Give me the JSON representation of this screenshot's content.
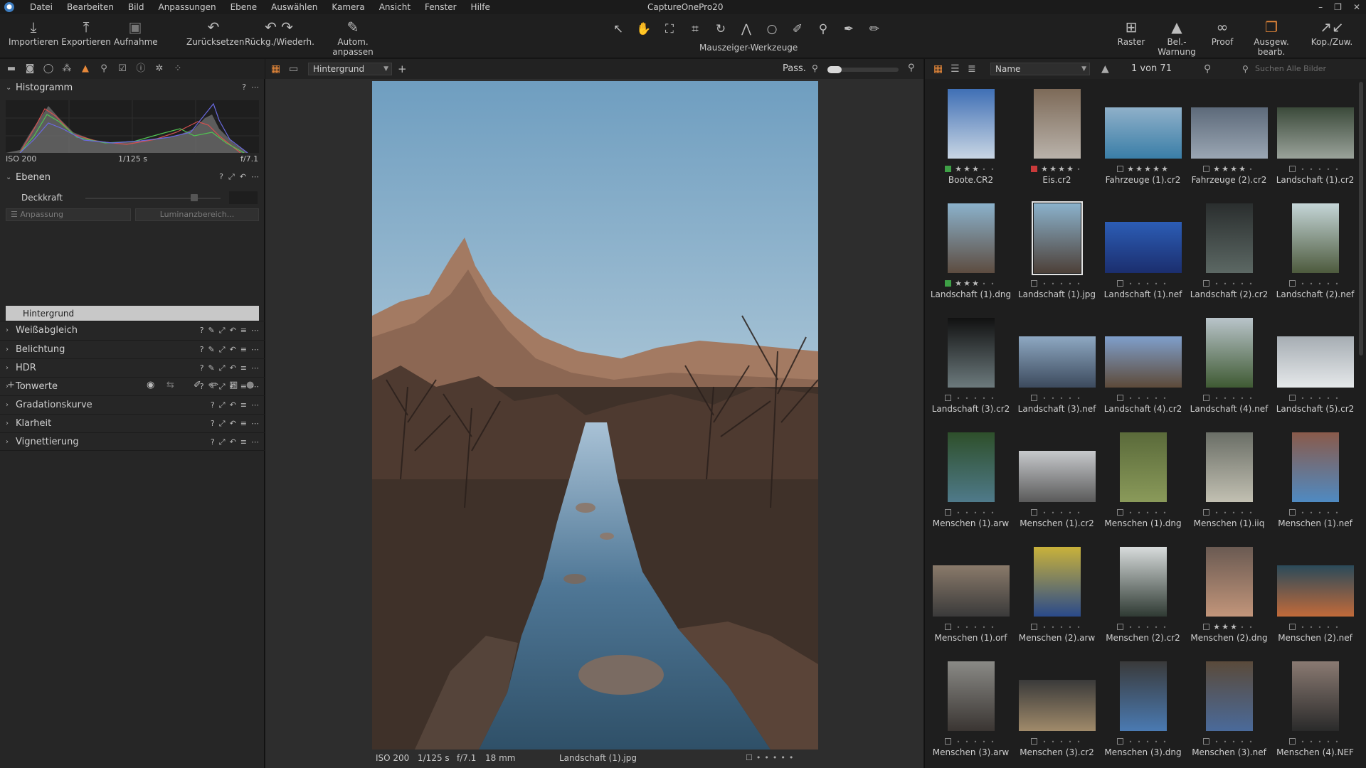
{
  "app": {
    "title": "CaptureOnePro20"
  },
  "menu": [
    "Datei",
    "Bearbeiten",
    "Bild",
    "Anpassungen",
    "Ebene",
    "Auswählen",
    "Kamera",
    "Ansicht",
    "Fenster",
    "Hilfe"
  ],
  "window_controls": [
    "–",
    "❐",
    "✕"
  ],
  "toolbar": {
    "left": [
      {
        "label": "Importieren",
        "icon": "import-icon"
      },
      {
        "label": "Exportieren",
        "icon": "export-icon"
      },
      {
        "label": "Aufnahme",
        "icon": "camera-icon"
      },
      {
        "label": "Zurücksetzen",
        "icon": "reset-icon"
      },
      {
        "label": "Rückg./Wiederh.",
        "icon": "undo-redo-icon"
      },
      {
        "label": "Autom. anpassen",
        "icon": "auto-adjust-icon"
      }
    ],
    "cursor_tools_label": "Mauszeiger-Werkzeuge",
    "right": [
      {
        "label": "Raster",
        "icon": "grid-icon"
      },
      {
        "label": "Bel.-Warnung",
        "icon": "exposure-warning-icon"
      },
      {
        "label": "Proof",
        "icon": "proof-glasses-icon"
      },
      {
        "label": "Ausgew. bearb.",
        "icon": "edit-selected-icon"
      },
      {
        "label": "Kop./Zuw.",
        "icon": "copy-apply-icon"
      }
    ]
  },
  "left_panel": {
    "histogram": {
      "title": "Histogramm",
      "iso": "ISO 200",
      "shutter": "1/125 s",
      "aperture": "f/7.1"
    },
    "layers": {
      "title": "Ebenen",
      "opacity_label": "Deckkraft",
      "opacity_level": 0.82,
      "adjustment_placeholder": "Anpassung",
      "luminance_placeholder": "Luminanzbereich...",
      "active_layer": "Hintergrund"
    },
    "tools": [
      "Weißabgleich",
      "Belichtung",
      "HDR",
      "Tonwerte",
      "Gradationskurve",
      "Klarheit",
      "Vignettierung"
    ]
  },
  "viewer": {
    "layer_select": "Hintergrund",
    "fit_label": "Pass.",
    "info": {
      "iso": "ISO 200",
      "shutter": "1/125 s",
      "aperture": "f/7.1",
      "focal": "18 mm",
      "filename": "Landschaft (1).jpg"
    }
  },
  "browser": {
    "sort": "Name",
    "count": "1 von 71",
    "search_placeholder": "Suchen Alle Bilder",
    "items": [
      {
        "name": "Boote.CR2",
        "stars": 3,
        "tag": "green",
        "orient": "p",
        "c1": "#3f6fb5",
        "c2": "#c9d6e4"
      },
      {
        "name": "Eis.cr2",
        "stars": 4,
        "tag": "red",
        "orient": "p",
        "c1": "#7d6a58",
        "c2": "#b9b2aa"
      },
      {
        "name": "Fahrzeuge (1).cr2",
        "stars": 5,
        "tag": "none",
        "orient": "l",
        "c1": "#8fb0c9",
        "c2": "#3a7ea7"
      },
      {
        "name": "Fahrzeuge (2).cr2",
        "stars": 4,
        "tag": "none",
        "orient": "l",
        "c1": "#5d6a7a",
        "c2": "#9aa6b3"
      },
      {
        "name": "Landschaft (1).cr2",
        "stars": 0,
        "tag": "none",
        "orient": "l",
        "c1": "#3b4a3a",
        "c2": "#9aa29a"
      },
      {
        "name": "Landschaft (1).dng",
        "stars": 3,
        "tag": "green",
        "orient": "p",
        "c1": "#8bb2cc",
        "c2": "#5d4c40"
      },
      {
        "name": "Landschaft (1).jpg",
        "stars": 0,
        "tag": "none",
        "orient": "p",
        "c1": "#8bb2cc",
        "c2": "#4d4038",
        "selected": true
      },
      {
        "name": "Landschaft (1).nef",
        "stars": 0,
        "tag": "none",
        "orient": "l",
        "c1": "#2c5db5",
        "c2": "#1b2e6e"
      },
      {
        "name": "Landschaft (2).cr2",
        "stars": 0,
        "tag": "none",
        "orient": "p",
        "c1": "#2a2e2e",
        "c2": "#5c6864"
      },
      {
        "name": "Landschaft (2).nef",
        "stars": 0,
        "tag": "none",
        "orient": "p",
        "c1": "#c5d6d8",
        "c2": "#4d5a3d"
      },
      {
        "name": "Landschaft (3).cr2",
        "stars": 0,
        "tag": "none",
        "orient": "p",
        "c1": "#111111",
        "c2": "#6c7a7d"
      },
      {
        "name": "Landschaft (3).nef",
        "stars": 0,
        "tag": "none",
        "orient": "l",
        "c1": "#8ea8c2",
        "c2": "#3c4a5d"
      },
      {
        "name": "Landschaft (4).cr2",
        "stars": 0,
        "tag": "none",
        "orient": "l",
        "c1": "#7f9fcb",
        "c2": "#5d4a39"
      },
      {
        "name": "Landschaft (4).nef",
        "stars": 0,
        "tag": "none",
        "orient": "p",
        "c1": "#b9c4ca",
        "c2": "#3f5a33"
      },
      {
        "name": "Landschaft (5).cr2",
        "stars": 0,
        "tag": "none",
        "orient": "l",
        "c1": "#a6adb3",
        "c2": "#e5e8ea"
      },
      {
        "name": "Menschen (1).arw",
        "stars": 0,
        "tag": "none",
        "orient": "p",
        "c1": "#2e4f2a",
        "c2": "#4f7a8a"
      },
      {
        "name": "Menschen (1).cr2",
        "stars": 0,
        "tag": "none",
        "orient": "l",
        "c1": "#c7c9cc",
        "c2": "#5a5a5a"
      },
      {
        "name": "Menschen (1).dng",
        "stars": 0,
        "tag": "none",
        "orient": "p",
        "c1": "#5a6a3a",
        "c2": "#8a9a5a"
      },
      {
        "name": "Menschen (1).iiq",
        "stars": 0,
        "tag": "none",
        "orient": "p",
        "c1": "#6a6e66",
        "c2": "#c2c0b2"
      },
      {
        "name": "Menschen (1).nef",
        "stars": 0,
        "tag": "none",
        "orient": "p",
        "c1": "#8a5a4a",
        "c2": "#4f8ac2"
      },
      {
        "name": "Menschen (1).orf",
        "stars": 0,
        "tag": "none",
        "orient": "l",
        "c1": "#8a7a6a",
        "c2": "#3a3a3a"
      },
      {
        "name": "Menschen (2).arw",
        "stars": 0,
        "tag": "none",
        "orient": "p",
        "c1": "#c9b23a",
        "c2": "#2a4a8a"
      },
      {
        "name": "Menschen (2).cr2",
        "stars": 0,
        "tag": "none",
        "orient": "p",
        "c1": "#d8dcdc",
        "c2": "#2f3a33"
      },
      {
        "name": "Menschen (2).dng",
        "stars": 3,
        "tag": "none",
        "orient": "p",
        "c1": "#6a5a52",
        "c2": "#c2957a"
      },
      {
        "name": "Menschen (2).nef",
        "stars": 0,
        "tag": "none",
        "orient": "l",
        "c1": "#2a4a5a",
        "c2": "#c26a3a"
      },
      {
        "name": "Menschen (3).arw",
        "stars": 0,
        "tag": "none",
        "orient": "p",
        "c1": "#8a8a86",
        "c2": "#3a3532"
      },
      {
        "name": "Menschen (3).cr2",
        "stars": 0,
        "tag": "none",
        "orient": "l",
        "c1": "#3a3a3a",
        "c2": "#a08a6a"
      },
      {
        "name": "Menschen (3).dng",
        "stars": 0,
        "tag": "none",
        "orient": "p",
        "c1": "#3a3a3a",
        "c2": "#4a7ab2"
      },
      {
        "name": "Menschen (3).nef",
        "stars": 0,
        "tag": "none",
        "orient": "p",
        "c1": "#5a4a3a",
        "c2": "#4a6a9a"
      },
      {
        "name": "Menschen (4).NEF",
        "stars": 0,
        "tag": "none",
        "orient": "p",
        "c1": "#8a7a72",
        "c2": "#2a2a2a"
      }
    ]
  },
  "colors": {
    "accent": "#e8893a",
    "panel": "#262626",
    "viewer": "#2d2d2d"
  }
}
